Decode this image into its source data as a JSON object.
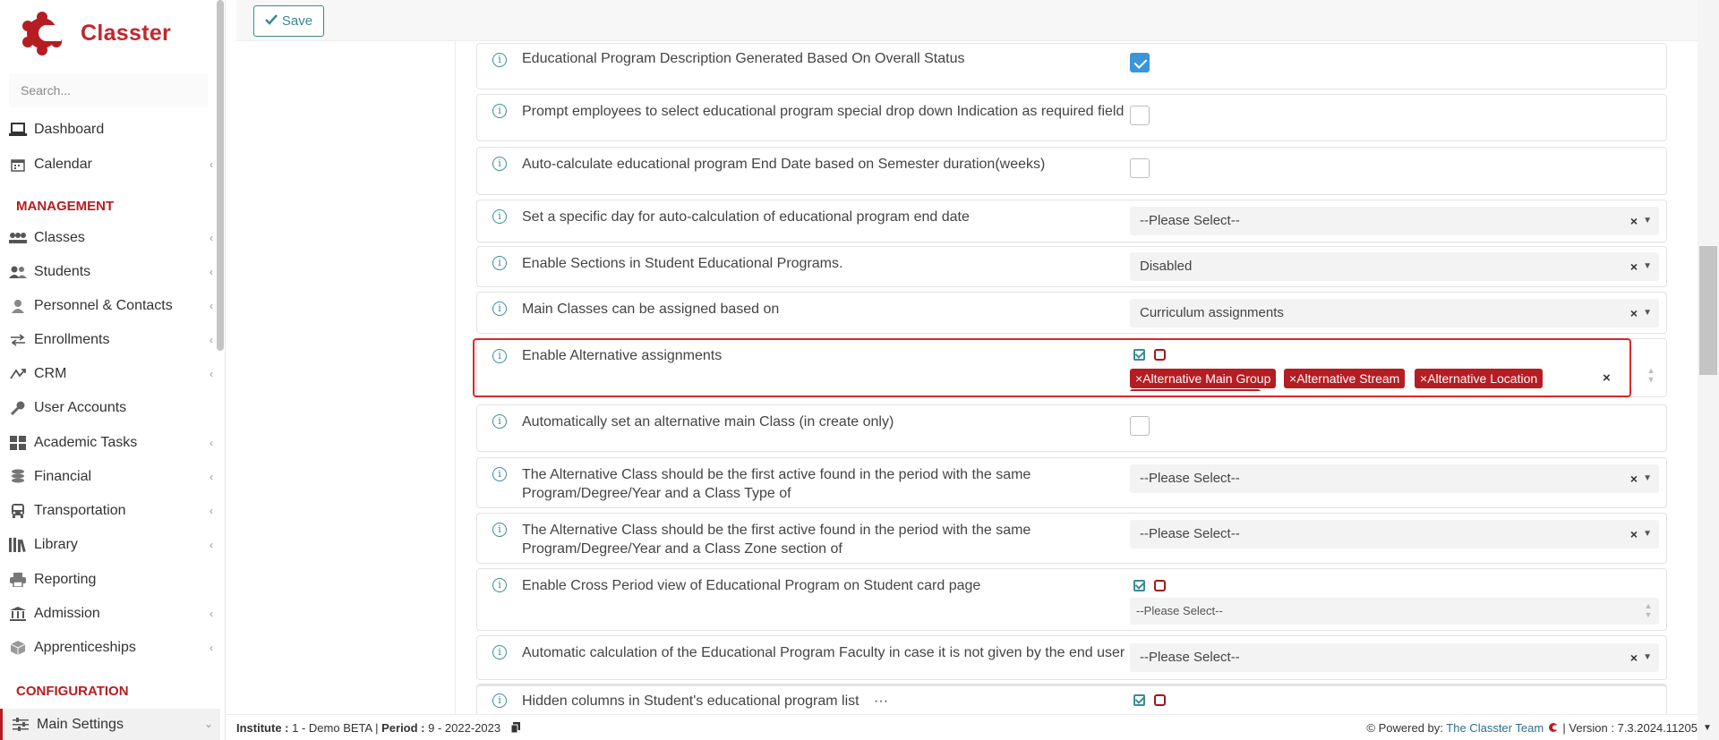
{
  "app": {
    "name": "Classter"
  },
  "search": {
    "placeholder": "Search..."
  },
  "nav": {
    "top": [
      {
        "label": "Dashboard",
        "icon": "laptop-icon"
      },
      {
        "label": "Calendar",
        "icon": "calendar-icon"
      }
    ],
    "management_title": "MANAGEMENT",
    "management": [
      {
        "label": "Classes",
        "icon": "classes-icon"
      },
      {
        "label": "Students",
        "icon": "students-icon"
      },
      {
        "label": "Personnel & Contacts",
        "icon": "personnel-icon"
      },
      {
        "label": "Enrollments",
        "icon": "enrollments-icon"
      },
      {
        "label": "CRM",
        "icon": "crm-icon"
      },
      {
        "label": "User Accounts",
        "icon": "key-icon"
      },
      {
        "label": "Academic Tasks",
        "icon": "tasks-icon"
      },
      {
        "label": "Financial",
        "icon": "coins-icon"
      },
      {
        "label": "Transportation",
        "icon": "bus-icon"
      },
      {
        "label": "Library",
        "icon": "library-icon"
      },
      {
        "label": "Reporting",
        "icon": "printer-icon"
      },
      {
        "label": "Admission",
        "icon": "institution-icon"
      },
      {
        "label": "Apprenticeships",
        "icon": "box-icon"
      }
    ],
    "configuration_title": "CONFIGURATION",
    "configuration": [
      {
        "label": "Main Settings",
        "icon": "sliders-icon"
      }
    ]
  },
  "toolbar": {
    "save_label": "Save"
  },
  "settings": [
    {
      "label": "Educational Program Description Generated Based On Overall Status",
      "type": "checkbox",
      "checked": true
    },
    {
      "label": "Prompt employees to select educational program special drop down Indication as required field",
      "type": "checkbox",
      "checked": false
    },
    {
      "label": "Auto-calculate educational program End Date based on Semester duration(weeks)",
      "type": "checkbox",
      "checked": false
    },
    {
      "label": "Set a specific day for auto-calculation of educational program end date",
      "type": "select",
      "value": "--Please Select--"
    },
    {
      "label": "Enable Sections in Student Educational Programs.",
      "type": "select",
      "value": "Disabled"
    },
    {
      "label": "Main Classes can be assigned based on",
      "type": "select",
      "value": "Curriculum assignments"
    },
    {
      "label": "Enable Alternative assignments",
      "type": "multiselect",
      "tags": [
        "Alternative Main Group",
        "Alternative Stream",
        "Alternative Location"
      ]
    },
    {
      "label": "Automatically set an alternative main Class (in create only)",
      "type": "checkbox",
      "checked": false
    },
    {
      "label": "The Alternative Class should be the first active found in the period with the same Program/Degree/Year and a Class Type of",
      "type": "select",
      "value": "--Please Select--"
    },
    {
      "label": "The Alternative Class should be the first active found in the period with the same Program/Degree/Year and a Class Zone section of",
      "type": "select",
      "value": "--Please Select--"
    },
    {
      "label": "Enable Cross Period view of Educational Program on Student card page",
      "type": "multiselect-empty",
      "value": "--Please Select--"
    },
    {
      "label": "Automatic calculation of the Educational Program Faculty in case it is not given by the end user",
      "type": "select",
      "value": "--Please Select--"
    },
    {
      "label": "Hidden columns in Student's educational program list",
      "type": "multiselect-partial",
      "more": "···"
    }
  ],
  "footer": {
    "institute_label": "Institute :",
    "institute_value": "1 - Demo BETA",
    "sep": "|",
    "period_label": "Period :",
    "period_value": "9 - 2022-2023",
    "powered_label": "Powered by:",
    "powered_link": "The Classter Team",
    "version": "| Version : 7.3.2024.11205"
  }
}
